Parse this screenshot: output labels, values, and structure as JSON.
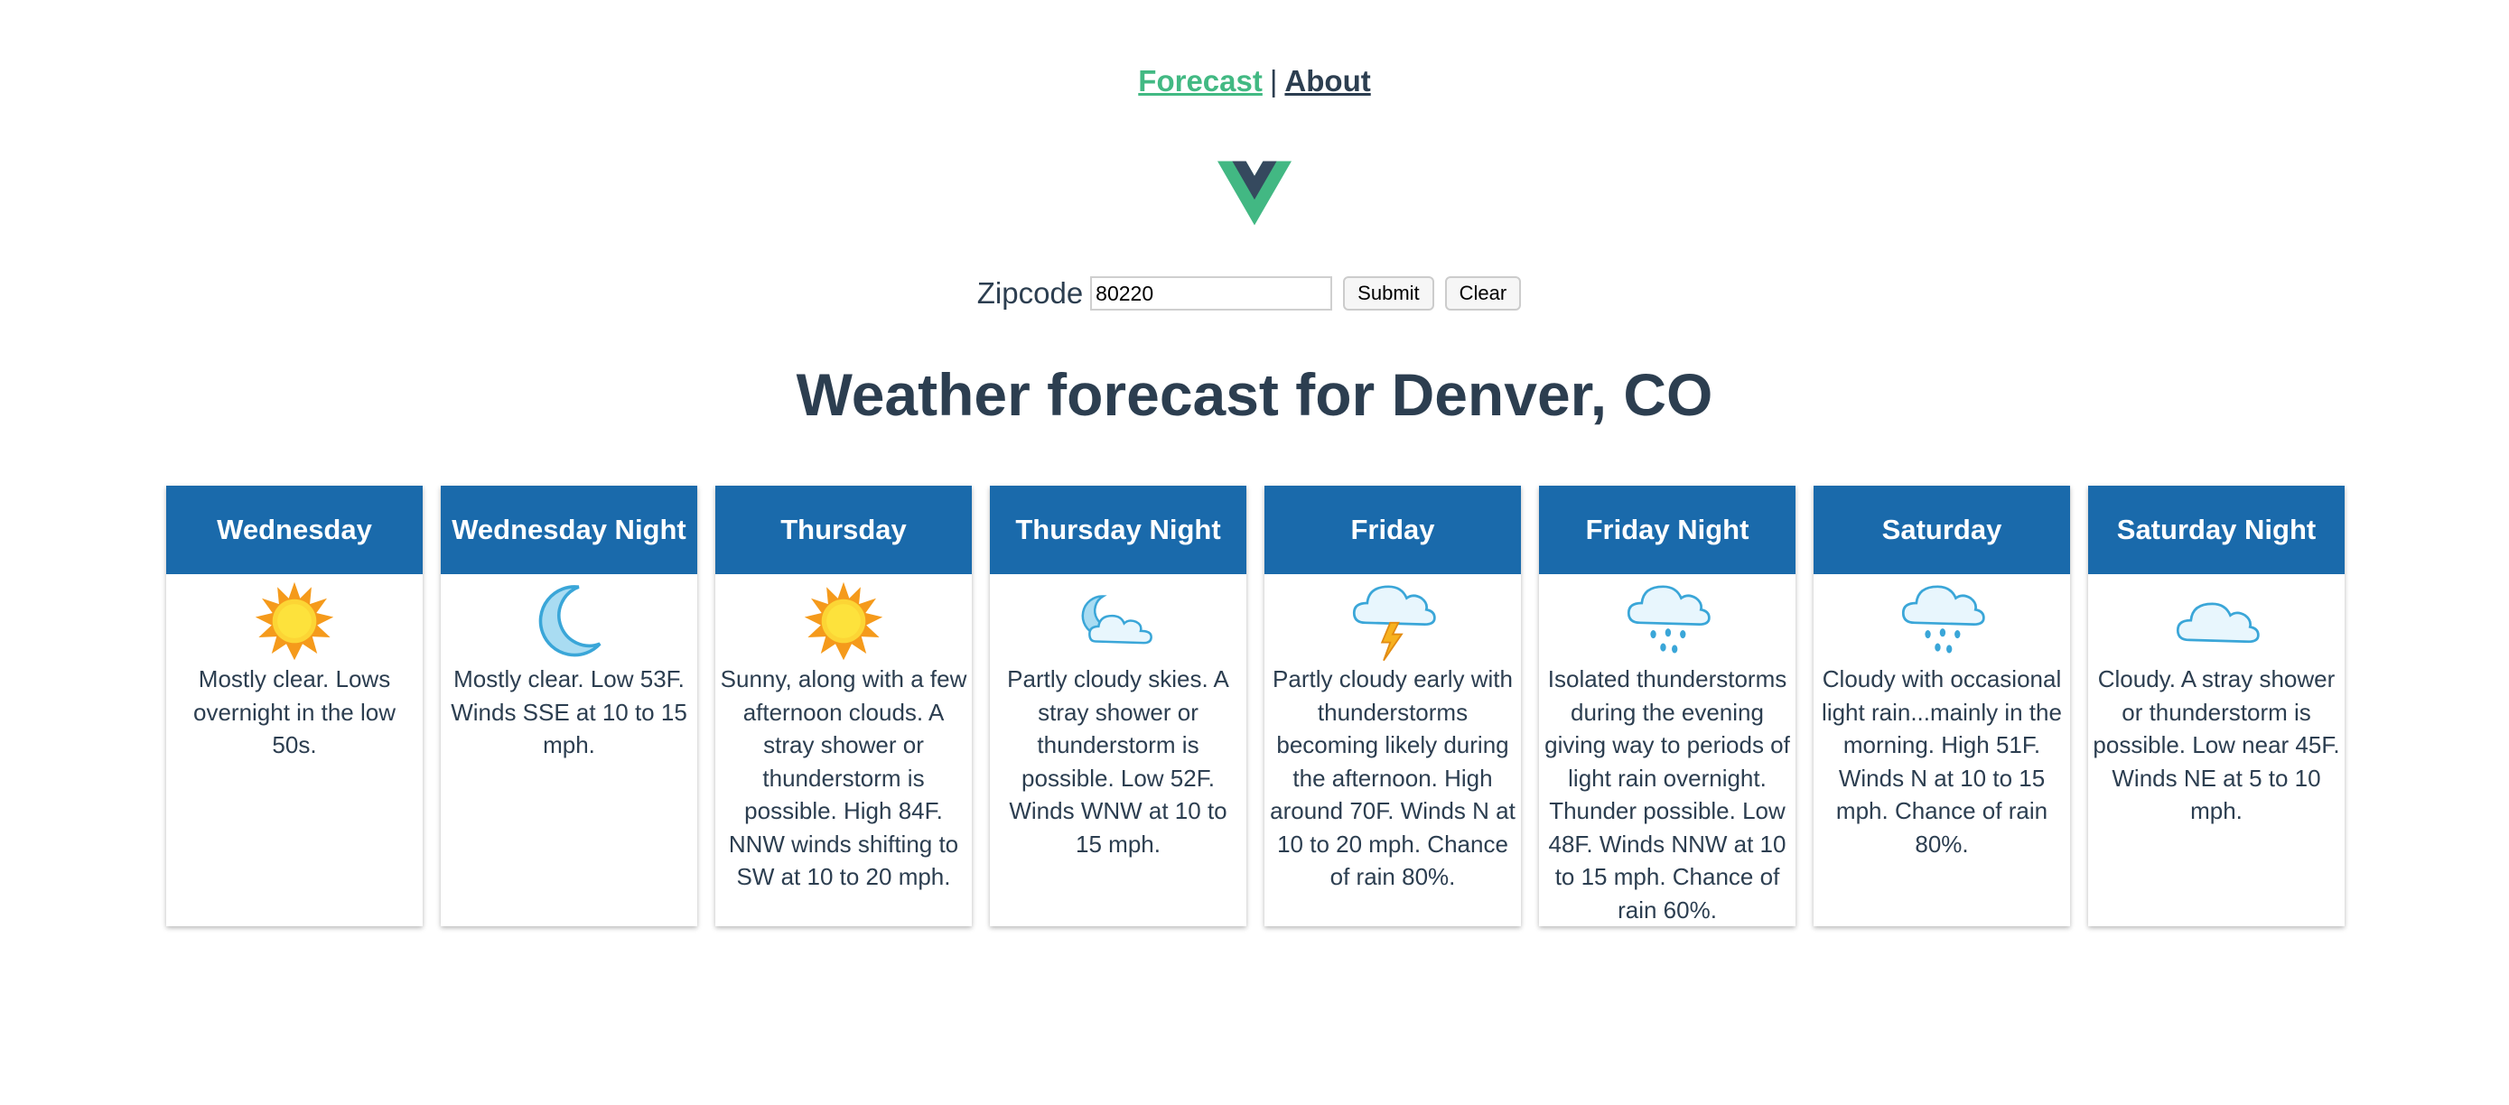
{
  "nav": {
    "forecast_label": "Forecast",
    "separator": "|",
    "about_label": "About"
  },
  "logo": {
    "icon": "vue-logo-icon",
    "colors": {
      "outer": "#42b883",
      "inner": "#35495e"
    }
  },
  "zip": {
    "label": "Zipcode",
    "value": "80220",
    "submit_label": "Submit",
    "clear_label": "Clear"
  },
  "heading": "Weather forecast for Denver, CO",
  "colors": {
    "card_header": "#1a6aab",
    "accent": "#42b983",
    "text": "#2c3e50"
  },
  "periods": [
    {
      "name": "Wednesday",
      "icon": "sun-icon",
      "text": "Mostly clear. Lows overnight in the low 50s."
    },
    {
      "name": "Wednesday Night",
      "icon": "moon-icon",
      "text": "Mostly clear. Low 53F. Winds SSE at 10 to 15 mph."
    },
    {
      "name": "Thursday",
      "icon": "sun-icon",
      "text": "Sunny, along with a few afternoon clouds. A stray shower or thunderstorm is possible. High 84F. NNW winds shifting to SW at 10 to 20 mph."
    },
    {
      "name": "Thursday Night",
      "icon": "moon-cloud-icon",
      "text": "Partly cloudy skies. A stray shower or thunderstorm is possible. Low 52F. Winds WNW at 10 to 15 mph."
    },
    {
      "name": "Friday",
      "icon": "thunderstorm-icon",
      "text": "Partly cloudy early with thunderstorms becoming likely during the afternoon. High around 70F. Winds N at 10 to 20 mph. Chance of rain 80%."
    },
    {
      "name": "Friday Night",
      "icon": "rain-cloud-icon",
      "text": "Isolated thunderstorms during the evening giving way to periods of light rain overnight. Thunder possible. Low 48F. Winds NNW at 10 to 15 mph. Chance of rain 60%."
    },
    {
      "name": "Saturday",
      "icon": "rain-cloud-icon",
      "text": "Cloudy with occasional light rain...mainly in the morning. High 51F. Winds N at 10 to 15 mph. Chance of rain 80%."
    },
    {
      "name": "Saturday Night",
      "icon": "cloud-icon",
      "text": "Cloudy. A stray shower or thunderstorm is possible. Low near 45F. Winds NE at 5 to 10 mph."
    }
  ]
}
